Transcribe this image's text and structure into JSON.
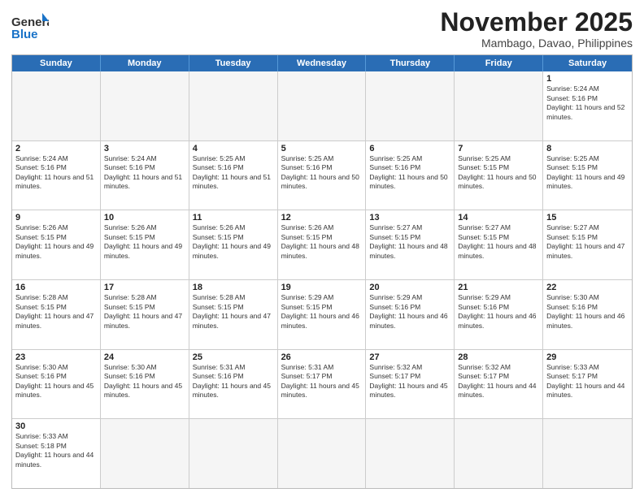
{
  "header": {
    "logo_general": "General",
    "logo_blue": "Blue",
    "title": "November 2025",
    "subtitle": "Mambago, Davao, Philippines"
  },
  "days_of_week": [
    "Sunday",
    "Monday",
    "Tuesday",
    "Wednesday",
    "Thursday",
    "Friday",
    "Saturday"
  ],
  "weeks": [
    [
      {
        "day": "",
        "empty": true
      },
      {
        "day": "",
        "empty": true
      },
      {
        "day": "",
        "empty": true
      },
      {
        "day": "",
        "empty": true
      },
      {
        "day": "",
        "empty": true
      },
      {
        "day": "",
        "empty": true
      },
      {
        "day": "1",
        "sunrise": "5:24 AM",
        "sunset": "5:16 PM",
        "daylight": "11 hours and 52 minutes."
      }
    ],
    [
      {
        "day": "2",
        "sunrise": "5:24 AM",
        "sunset": "5:16 PM",
        "daylight": "11 hours and 51 minutes."
      },
      {
        "day": "3",
        "sunrise": "5:24 AM",
        "sunset": "5:16 PM",
        "daylight": "11 hours and 51 minutes."
      },
      {
        "day": "4",
        "sunrise": "5:25 AM",
        "sunset": "5:16 PM",
        "daylight": "11 hours and 51 minutes."
      },
      {
        "day": "5",
        "sunrise": "5:25 AM",
        "sunset": "5:16 PM",
        "daylight": "11 hours and 50 minutes."
      },
      {
        "day": "6",
        "sunrise": "5:25 AM",
        "sunset": "5:16 PM",
        "daylight": "11 hours and 50 minutes."
      },
      {
        "day": "7",
        "sunrise": "5:25 AM",
        "sunset": "5:15 PM",
        "daylight": "11 hours and 50 minutes."
      },
      {
        "day": "8",
        "sunrise": "5:25 AM",
        "sunset": "5:15 PM",
        "daylight": "11 hours and 49 minutes."
      }
    ],
    [
      {
        "day": "9",
        "sunrise": "5:26 AM",
        "sunset": "5:15 PM",
        "daylight": "11 hours and 49 minutes."
      },
      {
        "day": "10",
        "sunrise": "5:26 AM",
        "sunset": "5:15 PM",
        "daylight": "11 hours and 49 minutes."
      },
      {
        "day": "11",
        "sunrise": "5:26 AM",
        "sunset": "5:15 PM",
        "daylight": "11 hours and 49 minutes."
      },
      {
        "day": "12",
        "sunrise": "5:26 AM",
        "sunset": "5:15 PM",
        "daylight": "11 hours and 48 minutes."
      },
      {
        "day": "13",
        "sunrise": "5:27 AM",
        "sunset": "5:15 PM",
        "daylight": "11 hours and 48 minutes."
      },
      {
        "day": "14",
        "sunrise": "5:27 AM",
        "sunset": "5:15 PM",
        "daylight": "11 hours and 48 minutes."
      },
      {
        "day": "15",
        "sunrise": "5:27 AM",
        "sunset": "5:15 PM",
        "daylight": "11 hours and 47 minutes."
      }
    ],
    [
      {
        "day": "16",
        "sunrise": "5:28 AM",
        "sunset": "5:15 PM",
        "daylight": "11 hours and 47 minutes."
      },
      {
        "day": "17",
        "sunrise": "5:28 AM",
        "sunset": "5:15 PM",
        "daylight": "11 hours and 47 minutes."
      },
      {
        "day": "18",
        "sunrise": "5:28 AM",
        "sunset": "5:15 PM",
        "daylight": "11 hours and 47 minutes."
      },
      {
        "day": "19",
        "sunrise": "5:29 AM",
        "sunset": "5:15 PM",
        "daylight": "11 hours and 46 minutes."
      },
      {
        "day": "20",
        "sunrise": "5:29 AM",
        "sunset": "5:16 PM",
        "daylight": "11 hours and 46 minutes."
      },
      {
        "day": "21",
        "sunrise": "5:29 AM",
        "sunset": "5:16 PM",
        "daylight": "11 hours and 46 minutes."
      },
      {
        "day": "22",
        "sunrise": "5:30 AM",
        "sunset": "5:16 PM",
        "daylight": "11 hours and 46 minutes."
      }
    ],
    [
      {
        "day": "23",
        "sunrise": "5:30 AM",
        "sunset": "5:16 PM",
        "daylight": "11 hours and 45 minutes."
      },
      {
        "day": "24",
        "sunrise": "5:30 AM",
        "sunset": "5:16 PM",
        "daylight": "11 hours and 45 minutes."
      },
      {
        "day": "25",
        "sunrise": "5:31 AM",
        "sunset": "5:16 PM",
        "daylight": "11 hours and 45 minutes."
      },
      {
        "day": "26",
        "sunrise": "5:31 AM",
        "sunset": "5:17 PM",
        "daylight": "11 hours and 45 minutes."
      },
      {
        "day": "27",
        "sunrise": "5:32 AM",
        "sunset": "5:17 PM",
        "daylight": "11 hours and 45 minutes."
      },
      {
        "day": "28",
        "sunrise": "5:32 AM",
        "sunset": "5:17 PM",
        "daylight": "11 hours and 44 minutes."
      },
      {
        "day": "29",
        "sunrise": "5:33 AM",
        "sunset": "5:17 PM",
        "daylight": "11 hours and 44 minutes."
      }
    ],
    [
      {
        "day": "30",
        "sunrise": "5:33 AM",
        "sunset": "5:18 PM",
        "daylight": "11 hours and 44 minutes."
      },
      {
        "day": "",
        "empty": true
      },
      {
        "day": "",
        "empty": true
      },
      {
        "day": "",
        "empty": true
      },
      {
        "day": "",
        "empty": true
      },
      {
        "day": "",
        "empty": true
      },
      {
        "day": "",
        "empty": true
      }
    ]
  ],
  "labels": {
    "sunrise": "Sunrise:",
    "sunset": "Sunset:",
    "daylight": "Daylight:"
  }
}
